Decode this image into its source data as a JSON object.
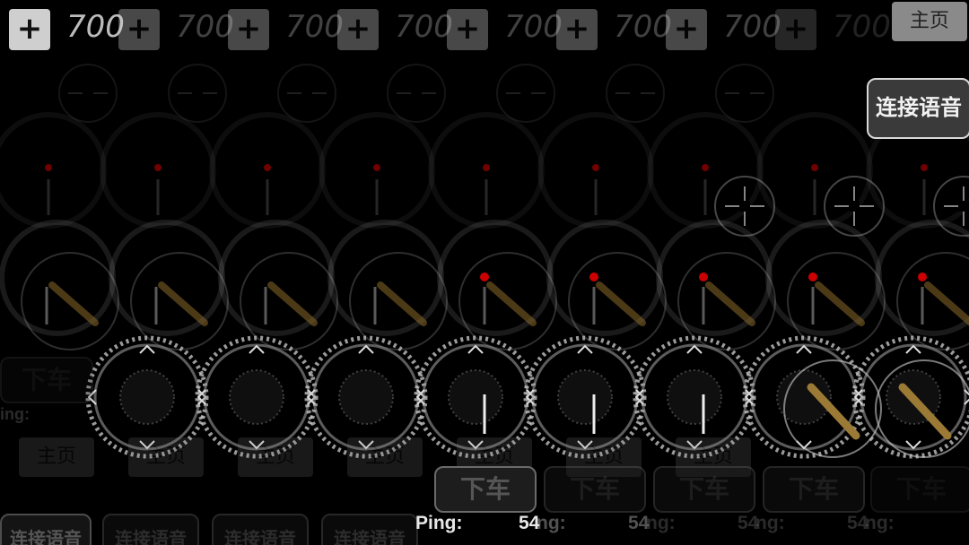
{
  "top_bar": {
    "plus_label": "+",
    "zoom_value": "700",
    "home_label": "主页"
  },
  "voice_button_label": "连接语音",
  "exit_vehicle_label": "下车",
  "ping": {
    "label": "Ping:",
    "value": "54"
  },
  "home_label": "主页",
  "echo_fragments": {
    "ng_label": "ng:",
    "ing_label": "ing:"
  },
  "colors": {
    "background": "#000000",
    "accent_red": "#cc0000",
    "button_light": "#cfcfcf"
  }
}
